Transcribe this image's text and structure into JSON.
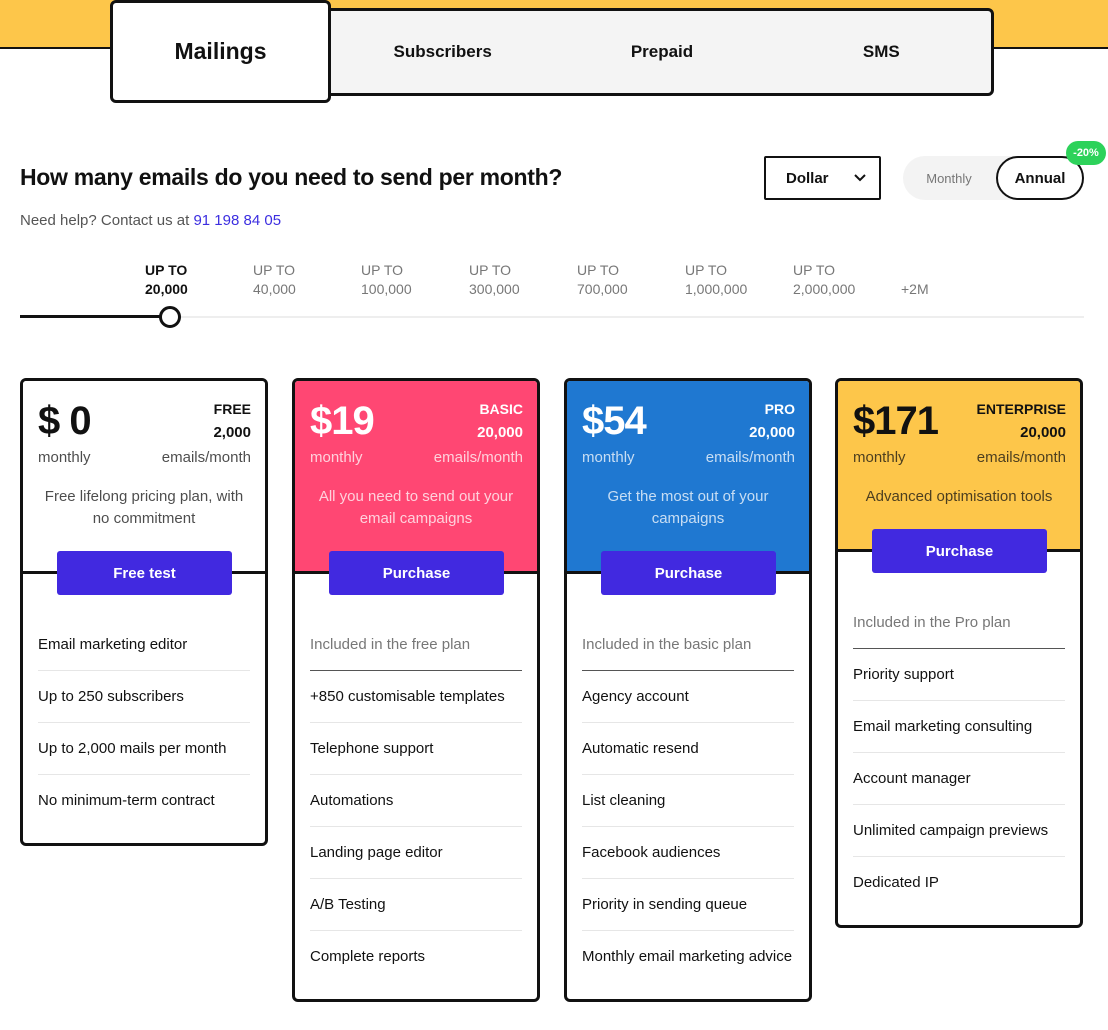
{
  "tabs": [
    {
      "label": "Mailings",
      "active": true
    },
    {
      "label": "Subscribers"
    },
    {
      "label": "Prepaid"
    },
    {
      "label": "SMS"
    }
  ],
  "header": {
    "title": "How many emails do you need to send per month?",
    "help_text": "Need help? Contact us at ",
    "phone": "91 198 84 05"
  },
  "currency": {
    "selected": "Dollar",
    "icon": "chevron-down-icon"
  },
  "billing": {
    "monthly": "Monthly",
    "annual": "Annual",
    "selected": "Annual",
    "discount": "-20%"
  },
  "slider": {
    "selected_index": 0,
    "ticks": [
      [
        "UP TO",
        "20,000"
      ],
      [
        "UP TO",
        "40,000"
      ],
      [
        "UP TO",
        "100,000"
      ],
      [
        "UP TO",
        "300,000"
      ],
      [
        "UP TO",
        "700,000"
      ],
      [
        "UP TO",
        "1,000,000"
      ],
      [
        "UP TO",
        "2,000,000"
      ],
      [
        "",
        "+2M"
      ]
    ]
  },
  "colors": {
    "brand_yellow": "#fdc64a",
    "basic": "#ff4773",
    "pro": "#1f78d1",
    "enterprise": "#fdc64a",
    "button": "#4129e0",
    "badge": "#2dd25a"
  },
  "plans": [
    {
      "price": "$ 0",
      "name": "FREE",
      "quantity": "2,000",
      "period": "monthly",
      "unit": "emails/month",
      "description": "Free lifelong pricing plan, with no commitment",
      "button": "Free test",
      "color": "#ffffff",
      "text_color": "#111111",
      "included": "",
      "features": [
        "Email marketing editor",
        "Up to 250 subscribers",
        "Up to 2,000 mails per month",
        "No minimum-term contract"
      ]
    },
    {
      "price": "$19",
      "name": "BASIC",
      "quantity": "20,000",
      "period": "monthly",
      "unit": "emails/month",
      "description": "All you need to send out your email campaigns",
      "button": "Purchase",
      "color": "#ff4773",
      "text_color": "#ffffff",
      "included": "Included in the free plan",
      "features": [
        "+850 customisable templates",
        "Telephone support",
        "Automations",
        "Landing page editor",
        "A/B Testing",
        "Complete reports"
      ]
    },
    {
      "price": "$54",
      "name": "PRO",
      "quantity": "20,000",
      "period": "monthly",
      "unit": "emails/month",
      "description": "Get the most out of your campaigns",
      "button": "Purchase",
      "color": "#1f78d1",
      "text_color": "#ffffff",
      "included": "Included in the basic plan",
      "features": [
        "Agency account",
        "Automatic resend",
        "List cleaning",
        "Facebook audiences",
        "Priority in sending queue",
        "Monthly email marketing advice"
      ]
    },
    {
      "price": "$171",
      "name": "ENTERPRISE",
      "quantity": "20,000",
      "period": "monthly",
      "unit": "emails/month",
      "description": "Advanced optimisation tools",
      "button": "Purchase",
      "color": "#fdc64a",
      "text_color": "#111111",
      "included": "Included in the Pro plan",
      "features": [
        "Priority support",
        "Email marketing consulting",
        "Account manager",
        "Unlimited campaign previews",
        "Dedicated IP"
      ]
    }
  ]
}
